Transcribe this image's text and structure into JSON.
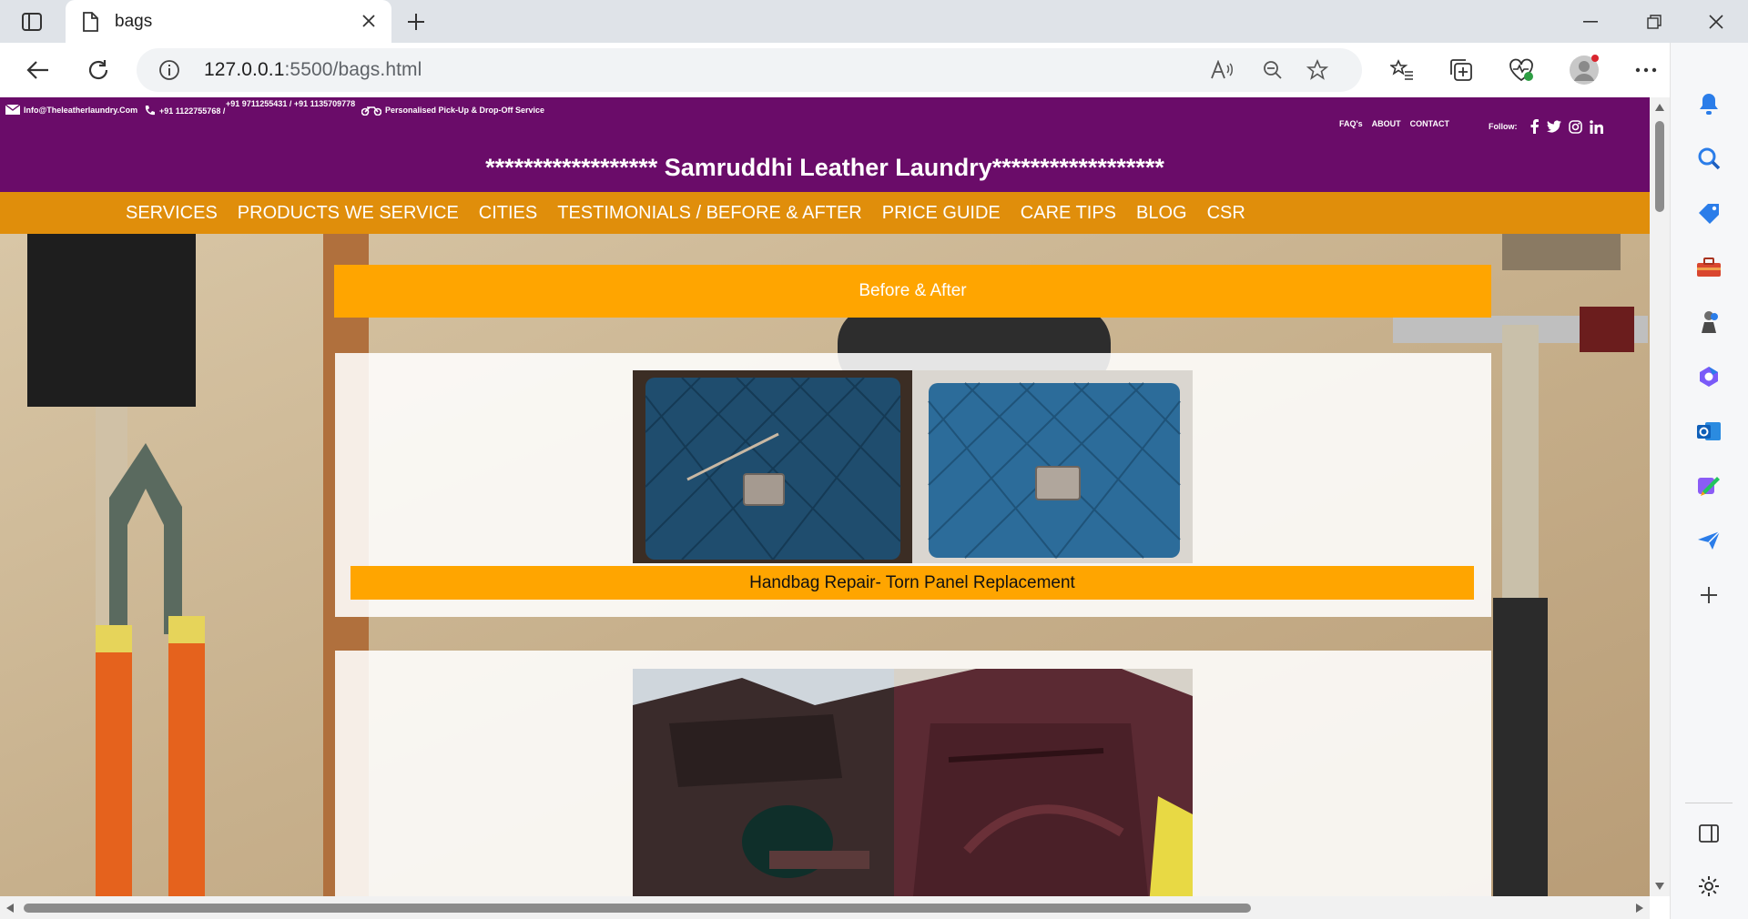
{
  "browser": {
    "tab": {
      "title": "bags"
    },
    "url": {
      "host": "127.0.0.1",
      "path": ":5500/bags.html"
    }
  },
  "site": {
    "contact": {
      "email": "Info@Theleatherlaundry.Com",
      "phone1": "+91 1122755768 /",
      "phone2": "+91 9711255431 / +91 1135709778",
      "service": "Personalised Pick-Up & Drop-Off Service"
    },
    "toplinks": [
      "FAQ's",
      "ABOUT",
      "CONTACT"
    ],
    "follow_label": "Follow:",
    "brand": "****************** Samruddhi Leather Laundry******************",
    "nav": [
      "SERVICES",
      "PRODUCTS WE SERVICE",
      "CITIES",
      "TESTIMONIALS / BEFORE & AFTER",
      "PRICE GUIDE",
      "CARE TIPS",
      "BLOG",
      "CSR"
    ],
    "section_title": "Before & After",
    "items": [
      {
        "caption": "Handbag Repair- Torn Panel Replacement"
      },
      {
        "caption": ""
      }
    ]
  },
  "colors": {
    "topbar": "#6a0c69",
    "nav": "#e08e0b",
    "accent": "#ffa500"
  }
}
